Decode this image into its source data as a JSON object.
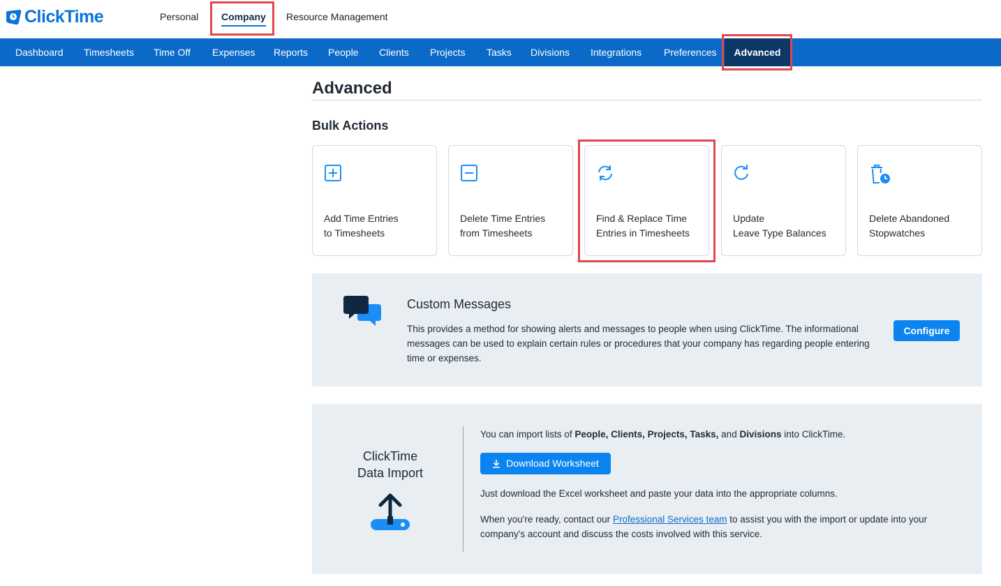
{
  "app": {
    "logo_text": "ClickTime"
  },
  "top_tabs": [
    {
      "label": "Personal"
    },
    {
      "label": "Company"
    },
    {
      "label": "Resource Management"
    }
  ],
  "nav": [
    {
      "label": "Dashboard"
    },
    {
      "label": "Timesheets"
    },
    {
      "label": "Time Off"
    },
    {
      "label": "Expenses"
    },
    {
      "label": "Reports"
    },
    {
      "label": "People"
    },
    {
      "label": "Clients"
    },
    {
      "label": "Projects"
    },
    {
      "label": "Tasks"
    },
    {
      "label": "Divisions"
    },
    {
      "label": "Integrations"
    },
    {
      "label": "Preferences"
    },
    {
      "label": "Advanced"
    }
  ],
  "page": {
    "title": "Advanced",
    "bulk_actions_title": "Bulk Actions"
  },
  "bulk_actions": [
    {
      "label": "Add Time Entries\nto Timesheets",
      "icon": "plus-square-icon"
    },
    {
      "label": "Delete Time Entries\nfrom Timesheets",
      "icon": "minus-square-icon"
    },
    {
      "label": "Find & Replace Time\nEntries in Timesheets",
      "icon": "refresh-icon"
    },
    {
      "label": "Update\nLeave Type Balances",
      "icon": "rotate-icon"
    },
    {
      "label": "Delete Abandoned\nStopwatches",
      "icon": "trash-clock-icon"
    }
  ],
  "custom_messages": {
    "title": "Custom Messages",
    "description": "This provides a method for showing alerts and messages to people when using ClickTime. The informational messages can be used to explain certain rules or procedures that your company has regarding people entering time or expenses.",
    "button": "Configure"
  },
  "data_import": {
    "title_line1": "ClickTime",
    "title_line2": "Data Import",
    "intro_pre": "You can import lists of ",
    "intro_bold1": "People, Clients, Projects, Tasks,",
    "intro_and": " and ",
    "intro_bold2": "Divisions",
    "intro_post": " into ClickTime.",
    "download_button": "Download Worksheet",
    "instructions": "Just download the Excel worksheet and paste your data into the appropriate columns.",
    "contact_pre": "When you're ready, contact our ",
    "contact_link": "Professional Services team",
    "contact_post": " to assist you with the import or update into your company's account and discuss the costs involved with this service."
  },
  "colors": {
    "brand_blue": "#0b6ac7",
    "nav_active": "#0c3766",
    "highlight_red": "#e0474c",
    "button_blue": "#0b84f0",
    "icon_blue": "#1a8ef5",
    "panel_bg": "#e9eef2"
  }
}
